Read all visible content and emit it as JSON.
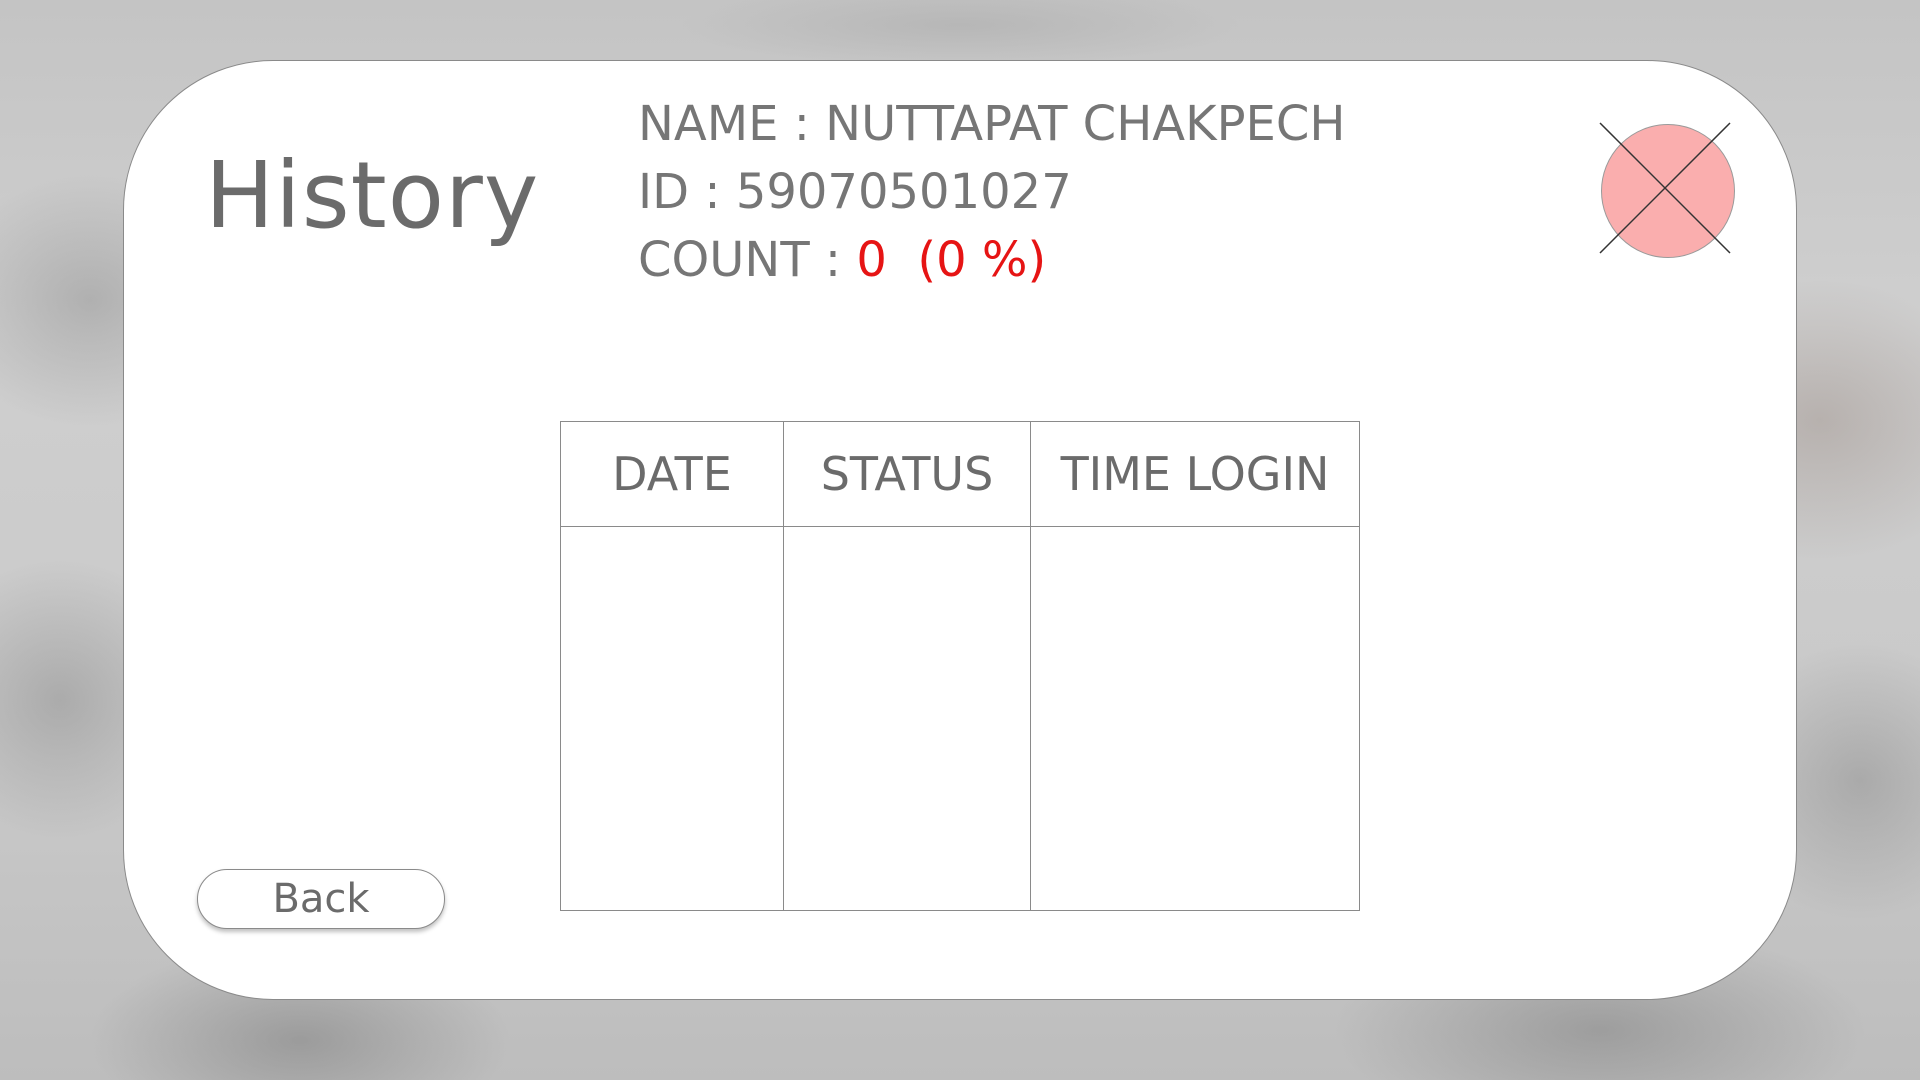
{
  "page": {
    "title": "History"
  },
  "user": {
    "name_label": "NAME : ",
    "name": "NUTTAPAT CHAKPECH",
    "id_label": "ID : ",
    "id": "59070501027",
    "count_label": "COUNT :  ",
    "count_value": "0",
    "count_percent": "(0 %)"
  },
  "table": {
    "columns": [
      "DATE",
      "STATUS",
      "TIME LOGIN"
    ],
    "rows": []
  },
  "buttons": {
    "back_label": "Back",
    "close_icon": "close-x-icon"
  },
  "colors": {
    "accent_red": "#e61414",
    "close_button_fill": "#faaeae",
    "text_gray": "#6b6b6b"
  }
}
